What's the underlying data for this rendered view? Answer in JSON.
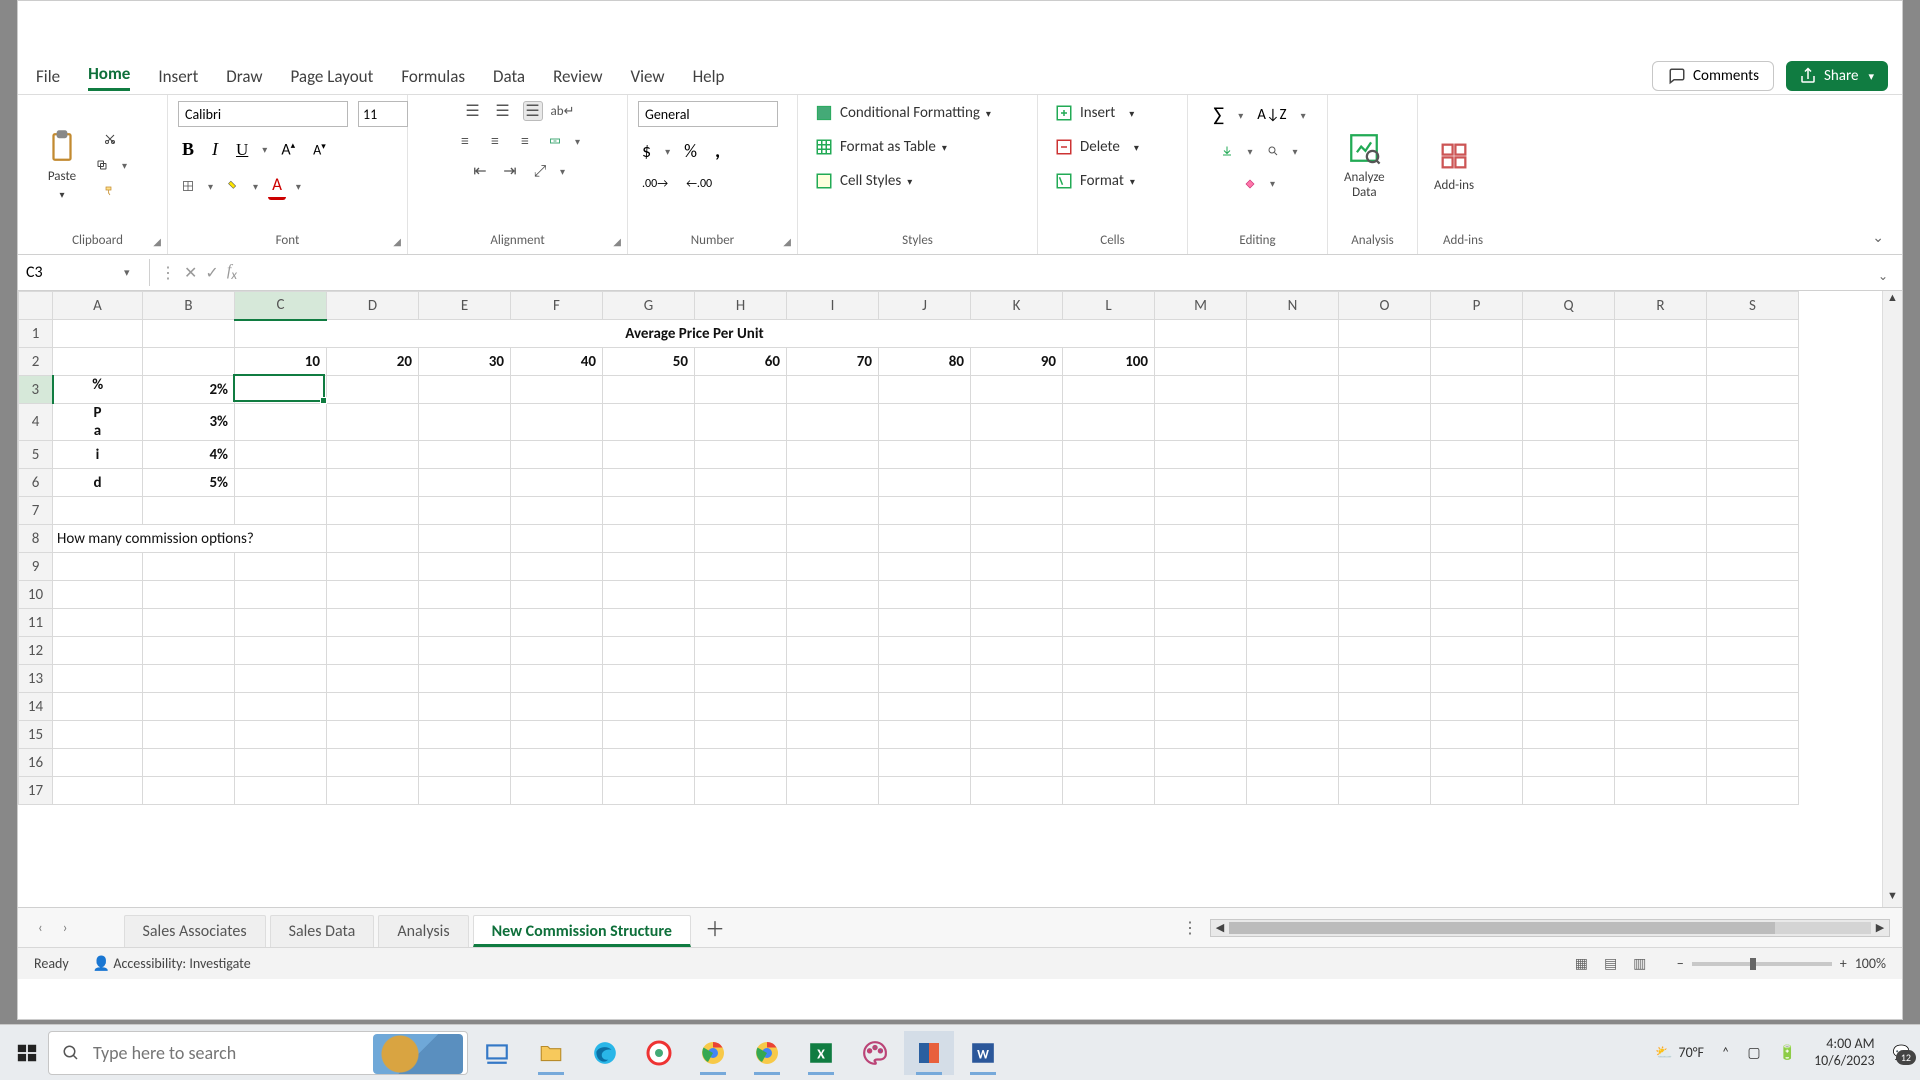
{
  "tabs": {
    "file": "File",
    "home": "Home",
    "insert": "Insert",
    "draw": "Draw",
    "page_layout": "Page Layout",
    "formulas": "Formulas",
    "data": "Data",
    "review": "Review",
    "view": "View",
    "help": "Help"
  },
  "top_right": {
    "comments": "Comments",
    "share": "Share"
  },
  "ribbon": {
    "clipboard": {
      "paste": "Paste",
      "label": "Clipboard"
    },
    "font": {
      "name": "Calibri",
      "size": "11",
      "label": "Font"
    },
    "alignment": {
      "label": "Alignment"
    },
    "number": {
      "format": "General",
      "label": "Number"
    },
    "styles": {
      "cond_fmt": "Conditional Formatting",
      "as_table": "Format as Table",
      "cell_styles": "Cell Styles",
      "label": "Styles"
    },
    "cells": {
      "insert": "Insert",
      "delete": "Delete",
      "format": "Format",
      "label": "Cells"
    },
    "editing": {
      "label": "Editing"
    },
    "analysis": {
      "analyze": "Analyze\nData",
      "label": "Analysis"
    },
    "addins": {
      "addins": "Add-ins",
      "label": "Add-ins"
    }
  },
  "namebox": "C3",
  "formula": "",
  "columns": [
    "A",
    "B",
    "C",
    "D",
    "E",
    "F",
    "G",
    "H",
    "I",
    "J",
    "K",
    "L",
    "M",
    "N",
    "O",
    "P",
    "Q",
    "R",
    "S"
  ],
  "grid": {
    "title": "Average Price Per Unit",
    "col_vals": [
      "10",
      "20",
      "30",
      "40",
      "50",
      "60",
      "70",
      "80",
      "90",
      "100"
    ],
    "side_label_lines": [
      "%",
      "P",
      "a",
      "i",
      "d"
    ],
    "row_pcts": [
      "2%",
      "3%",
      "4%",
      "5%"
    ],
    "question": "How many commission options?"
  },
  "chart_data": {
    "type": "table",
    "title": "Average Price Per Unit",
    "column_header": "Average Price Per Unit",
    "row_header": "% Paid",
    "columns": [
      10,
      20,
      30,
      40,
      50,
      60,
      70,
      80,
      90,
      100
    ],
    "rows_pct": [
      0.02,
      0.03,
      0.04,
      0.05
    ],
    "values": null,
    "note": "Body cells are blank in the screenshot"
  },
  "sheets": {
    "nav_prev": "‹",
    "nav_next": "›",
    "tabs": [
      "Sales Associates",
      "Sales Data",
      "Analysis",
      "New Commission Structure"
    ],
    "active_index": 3
  },
  "status": {
    "ready": "Ready",
    "accessibility": "Accessibility: Investigate",
    "zoom": "100%"
  },
  "taskbar": {
    "search_placeholder": "Type here to search",
    "weather": "70°F",
    "time": "4:00 AM",
    "date": "10/6/2023",
    "notif_count": "12"
  }
}
